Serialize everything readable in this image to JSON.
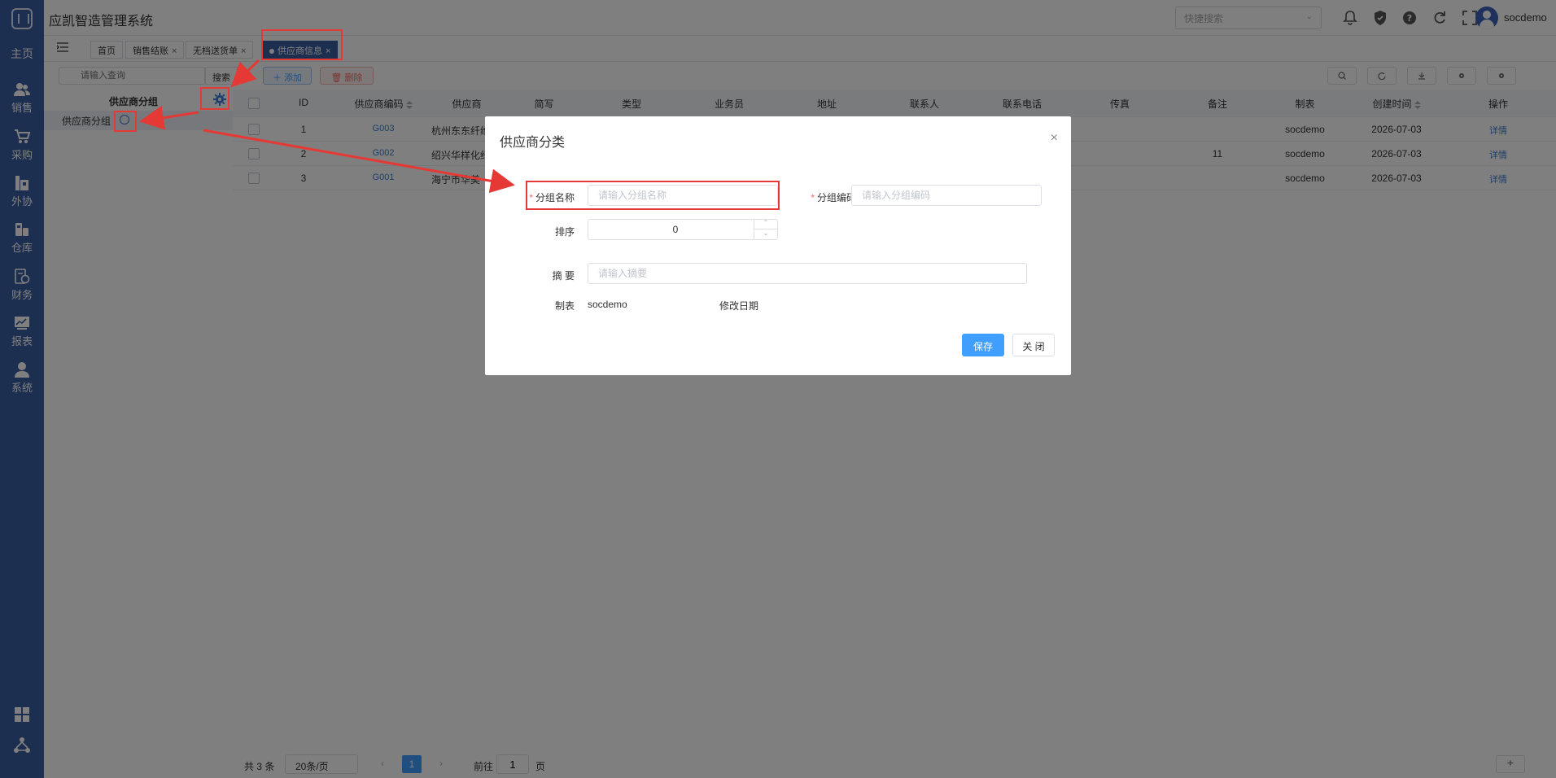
{
  "app": {
    "title": "应凯智造管理系统"
  },
  "header": {
    "quick_search_placeholder": "快捷搜索",
    "user_name": "socdemo",
    "icons": [
      "bell-icon",
      "shield-icon",
      "help-icon",
      "refresh-icon",
      "fullscreen-icon"
    ]
  },
  "sidebar": {
    "home": "主页",
    "items": [
      {
        "label": "销售",
        "icon": "users-icon"
      },
      {
        "label": "采购",
        "icon": "cart-icon"
      },
      {
        "label": "外协",
        "icon": "factory-icon"
      },
      {
        "label": "仓库",
        "icon": "warehouse-icon"
      },
      {
        "label": "财务",
        "icon": "finance-icon"
      },
      {
        "label": "报表",
        "icon": "chart-icon"
      },
      {
        "label": "系统",
        "icon": "user-icon"
      }
    ],
    "bottom_icons": [
      "apps-grid-icon",
      "network-icon"
    ]
  },
  "tabs": [
    {
      "label": "首页",
      "closable": false
    },
    {
      "label": "销售结账",
      "closable": true
    },
    {
      "label": "无档送货单",
      "closable": true
    },
    {
      "label": "供应商信息",
      "closable": true,
      "active": true
    }
  ],
  "group_panel": {
    "search_placeholder": "请输入查询",
    "search_button": "搜索",
    "title": "供应商分组",
    "item": "供应商分组"
  },
  "toolbar": {
    "add": "添加",
    "delete": "删除"
  },
  "table": {
    "columns": [
      "ID",
      "供应商编码",
      "供应商",
      "简写",
      "类型",
      "业务员",
      "地址",
      "联系人",
      "联系电话",
      "传真",
      "备注",
      "制表",
      "创建时间",
      "操作"
    ],
    "rows": [
      {
        "id": "1",
        "code": "G003",
        "supplier": "杭州东东纤维",
        "remark": "",
        "creator": "socdemo",
        "created": "2026-07-03",
        "action": "详情"
      },
      {
        "id": "2",
        "code": "G002",
        "supplier": "绍兴华样化纤",
        "remark": "11",
        "creator": "socdemo",
        "created": "2026-07-03",
        "action": "详情"
      },
      {
        "id": "3",
        "code": "G001",
        "supplier": "海宁市华美",
        "remark": "",
        "creator": "socdemo",
        "created": "2026-07-03",
        "action": "详情"
      }
    ]
  },
  "pager": {
    "total": "共 3 条",
    "page_size": "20条/页",
    "current_page": "1",
    "goto_prefix": "前往",
    "goto_value": "1",
    "goto_suffix": "页"
  },
  "dialog": {
    "title": "供应商分类",
    "close_glyph": "×",
    "group_name_label": "分组名称",
    "group_name_placeholder": "请输入分组名称",
    "group_code_label": "分组编码",
    "group_code_placeholder": "请输入分组编码",
    "sort_label": "排序",
    "sort_value": "0",
    "summary_label": "摘 要",
    "summary_placeholder": "请输入摘要",
    "creator_label": "制表",
    "creator_value": "socdemo",
    "modified_label": "修改日期",
    "save": "保存",
    "close": "关 闭"
  },
  "colors": {
    "sidebar": "#3a5ea3",
    "primary": "#409eff",
    "danger": "#f56c6c",
    "annotation": "#e53935"
  }
}
